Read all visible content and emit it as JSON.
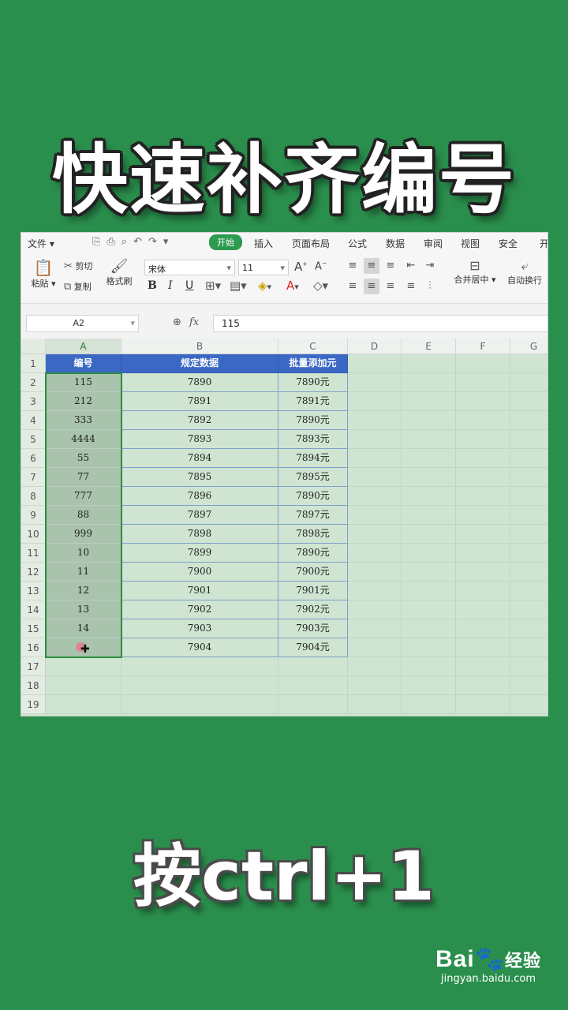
{
  "title": "快速补齐编号",
  "caption": "按ctrl+1",
  "watermark": {
    "brand": "Bai",
    "brand_tail": "经验",
    "url": "jingyan.baidu.com"
  },
  "menubar": {
    "file": "文件",
    "tabs": [
      "开始",
      "插入",
      "页面布局",
      "公式",
      "数据",
      "审阅",
      "视图",
      "安全",
      "开"
    ],
    "active_tab": "开始"
  },
  "ribbon": {
    "paste": "粘贴",
    "cut": "剪切",
    "copy": "复制",
    "format_painter": "格式刷",
    "font_name": "宋体",
    "font_size": "11",
    "merge_center": "合并居中",
    "wrap_text": "自动换行"
  },
  "formula_bar": {
    "name_box": "A2",
    "fx": "fx",
    "value": "115"
  },
  "columns": [
    "A",
    "B",
    "C",
    "D",
    "E",
    "F",
    "G"
  ],
  "rows": [
    "1",
    "2",
    "3",
    "4",
    "5",
    "6",
    "7",
    "8",
    "9",
    "10",
    "11",
    "12",
    "13",
    "14",
    "15",
    "16",
    "17",
    "18",
    "19"
  ],
  "table": {
    "headers": [
      "编号",
      "规定数据",
      "批量添加元"
    ],
    "data": [
      [
        "115",
        "7890",
        "7890元"
      ],
      [
        "212",
        "7891",
        "7891元"
      ],
      [
        "333",
        "7892",
        "7890元"
      ],
      [
        "4444",
        "7893",
        "7893元"
      ],
      [
        "55",
        "7894",
        "7894元"
      ],
      [
        "77",
        "7895",
        "7895元"
      ],
      [
        "777",
        "7896",
        "7890元"
      ],
      [
        "88",
        "7897",
        "7897元"
      ],
      [
        "999",
        "7898",
        "7898元"
      ],
      [
        "10",
        "7899",
        "7890元"
      ],
      [
        "11",
        "7900",
        "7900元"
      ],
      [
        "12",
        "7901",
        "7901元"
      ],
      [
        "13",
        "7902",
        "7902元"
      ],
      [
        "14",
        "7903",
        "7903元"
      ],
      [
        "",
        "7904",
        "7904元"
      ]
    ]
  },
  "colors": {
    "background": "#2a8f4c",
    "header_fill": "#3a68c4",
    "active_tab": "#2e9a4e"
  }
}
